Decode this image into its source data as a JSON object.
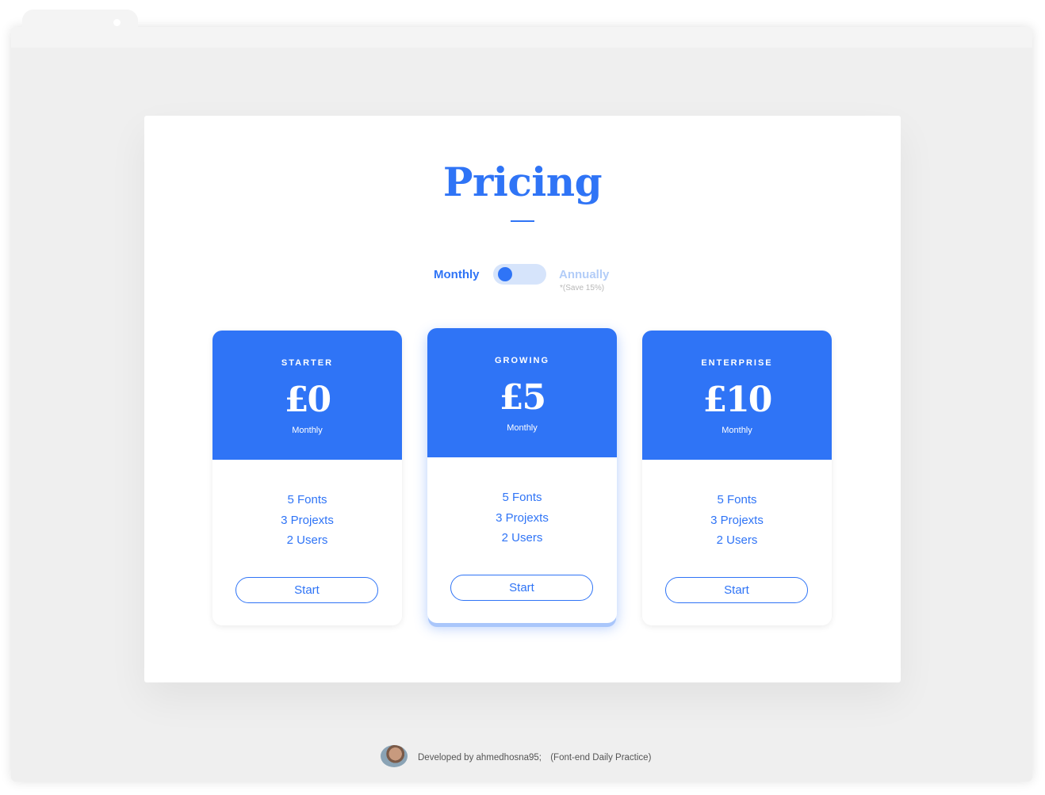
{
  "page": {
    "title": "Pricing",
    "accent_color": "#2f74f6"
  },
  "billing_toggle": {
    "monthly_label": "Monthly",
    "annually_label": "Annually",
    "save_note": "*(Save 15%)",
    "selected": "Monthly"
  },
  "plans": [
    {
      "name": "STARTER",
      "price": "£0",
      "period": "Monthly",
      "features": [
        "5 Fonts",
        "3 Projexts",
        "2 Users"
      ],
      "button_label": "Start",
      "featured": false
    },
    {
      "name": "GROWING",
      "price": "£5",
      "period": "Monthly",
      "features": [
        "5 Fonts",
        "3 Projexts",
        "2 Users"
      ],
      "button_label": "Start",
      "featured": true
    },
    {
      "name": "ENTERPRISE",
      "price": "£10",
      "period": "Monthly",
      "features": [
        "5 Fonts",
        "3 Projexts",
        "2 Users"
      ],
      "button_label": "Start",
      "featured": false
    }
  ],
  "footer": {
    "credit": "Developed by ahmedhosna95;",
    "note": "(Font-end Daily Practice)"
  }
}
